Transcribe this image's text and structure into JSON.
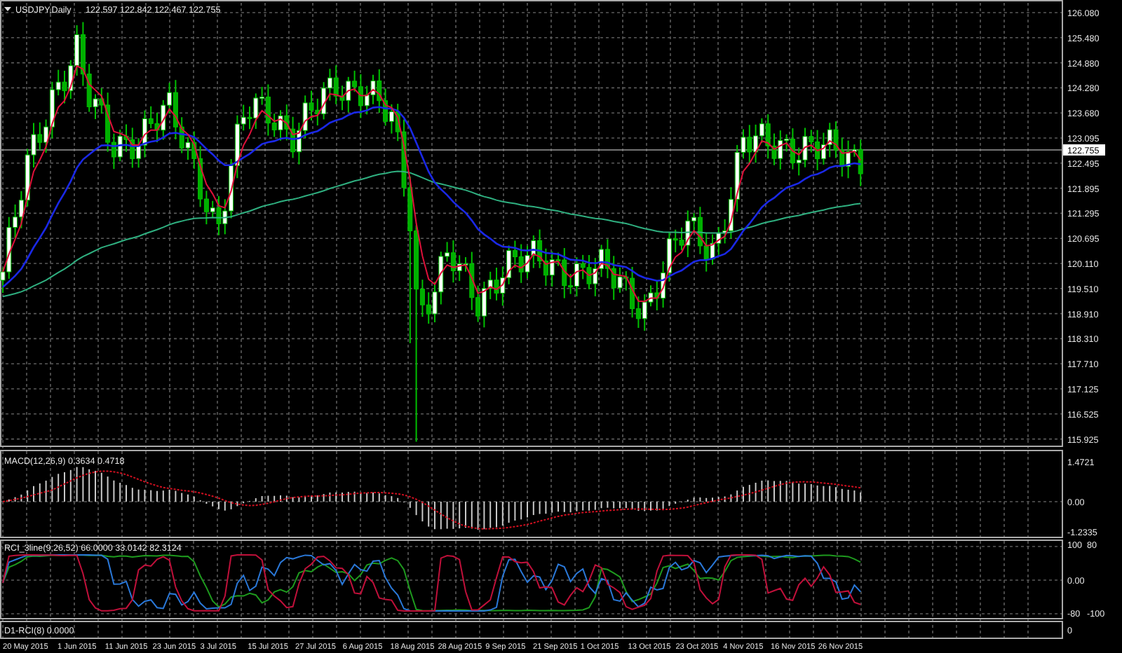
{
  "chart": {
    "symbol_label": "USDJPY,Daily",
    "ohlc": "122.597 122.842 122.467 122.755",
    "price_axis": [
      "126.080",
      "125.480",
      "124.880",
      "124.280",
      "123.680",
      "123.095",
      "122.495",
      "121.895",
      "121.295",
      "120.695",
      "120.110",
      "119.510",
      "118.910",
      "118.310",
      "117.710",
      "117.125",
      "116.525",
      "115.925"
    ],
    "current_price": "122.755"
  },
  "macd": {
    "label": "MACD(12,26,9) 0.3634 0.4718",
    "axis": [
      "1.4721",
      "0.00",
      "-1.2335"
    ]
  },
  "rci": {
    "label": "RCI_3line(9,26,52) 66.0000 33.0142 82.3124",
    "axis": [
      "100",
      "80",
      "0.00",
      "-80",
      "-100"
    ]
  },
  "d1_rci": {
    "label": "D1-RCI(8) 0.0000",
    "axis": [
      "0"
    ]
  },
  "time_axis": [
    "20 May 2015",
    "1 Jun 2015",
    "11 Jun 2015",
    "23 Jun 2015",
    "3 Jul 2015",
    "15 Jul 2015",
    "27 Jul 2015",
    "6 Aug 2015",
    "18 Aug 2015",
    "28 Aug 2015",
    "9 Sep 2015",
    "21 Sep 2015",
    "1 Oct 2015",
    "13 Oct 2015",
    "23 Oct 2015",
    "4 Nov 2015",
    "16 Nov 2015",
    "26 Nov 2015"
  ]
}
